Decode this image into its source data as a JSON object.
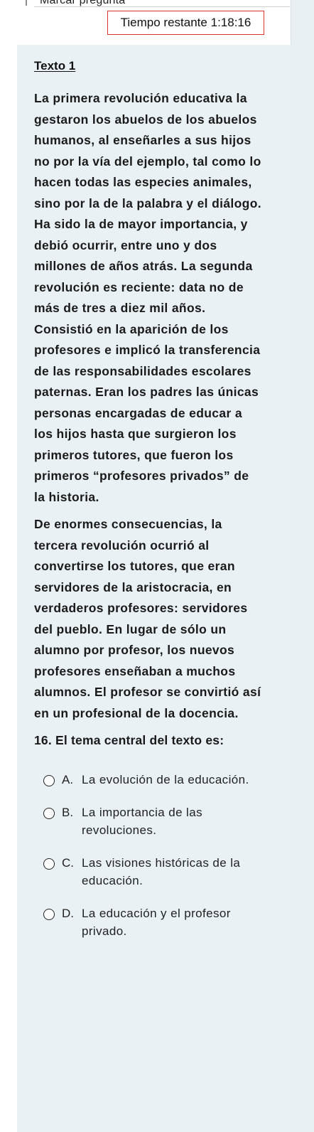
{
  "header": {
    "flag_label": "Marcar pregunta",
    "timer_label": "Tiempo restante",
    "timer_value": "1:18:16"
  },
  "reading": {
    "title": "Texto 1",
    "paragraphs": [
      "La primera revolución educativa la gestaron los abuelos de los abuelos humanos, al enseñarles a sus hijos no por la vía del ejemplo, tal como lo hacen todas las especies animales, sino por la de la palabra y el diálogo. Ha sido la de mayor importancia, y debió ocurrir, entre uno y dos millones de años atrás. La segunda revolución es reciente: data no de más de tres a diez mil años. Consistió en la aparición de los profesores e implicó la transferencia de las responsabilidades escolares paternas. Eran los padres las únicas personas encargadas de educar a los hijos hasta que surgieron los primeros tutores, que fueron los primeros “profesores privados” de la historia.",
      "De enormes consecuencias, la tercera revolución ocurrió al convertirse los tutores, que eran servidores de la aristocracia, en verdaderos profesores: servidores del pueblo. En lugar de sólo un alumno por profesor, los nuevos profesores enseñaban a muchos alumnos. El profesor se convirtió así en un profesional de la docencia."
    ]
  },
  "question": {
    "text": "16. El tema central del texto es:",
    "options": [
      {
        "letter": "A.",
        "text": "La evolución de la educación."
      },
      {
        "letter": "B.",
        "text": "La importancia de las revoluciones."
      },
      {
        "letter": "C.",
        "text": "Las visiones históricas de la educación."
      },
      {
        "letter": "D.",
        "text": "La educación y el profesor privado."
      }
    ]
  },
  "colors": {
    "panel_bg": "#e9f1f4",
    "timer_border": "#d9342b",
    "gutter_bg": "#e8f0f4"
  }
}
